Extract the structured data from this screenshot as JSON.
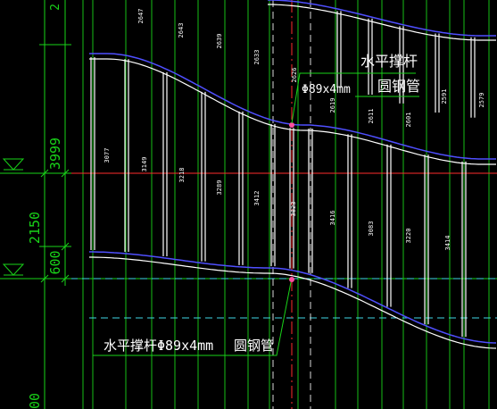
{
  "colors": {
    "background": "#000000",
    "dimension": "#19d319",
    "member": "#ffffff",
    "chord": "#4f4fff",
    "axis_red": "#ff2d2d",
    "level_cyan": "#3fd6e6",
    "axis_white_dash": "#d8d8d8",
    "node": "#ff4fa0"
  },
  "left_dims": {
    "top_clip": "2",
    "dim_3999": "3999",
    "dim_2150": "2150",
    "dim_600": "600",
    "bottom_clip": "00"
  },
  "upper_member_lengths": [
    "2647",
    "2643",
    "2639",
    "2633",
    "2626",
    "2619",
    "2611",
    "2601",
    "2591",
    "2579"
  ],
  "lower_member_lengths": [
    "3077",
    "3149",
    "3218",
    "3289",
    "3412",
    "3823",
    "3416",
    "3083",
    "3220",
    "3414"
  ],
  "annotations": {
    "top": {
      "title": "水平撑杆",
      "spec": "Φ89x4mm",
      "type": "圆钢管"
    },
    "bottom": {
      "title_spec": "水平撑杆Φ89x4mm",
      "type": "圆钢管"
    }
  }
}
